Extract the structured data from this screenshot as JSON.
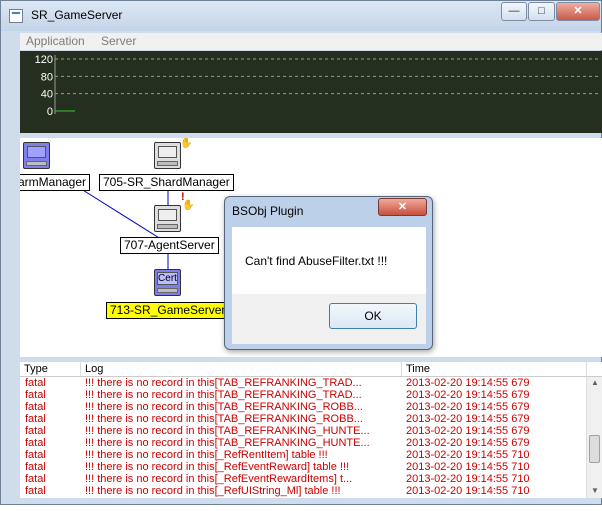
{
  "window": {
    "title": "SR_GameServer",
    "min_glyph": "—",
    "max_glyph": "□",
    "close_glyph": "✕"
  },
  "menu": {
    "items": [
      {
        "label": "Application"
      },
      {
        "label": "Server"
      }
    ]
  },
  "chart_data": {
    "type": "line",
    "title": "",
    "xlabel": "",
    "ylabel": "",
    "y_ticks": [
      120,
      80,
      40,
      0
    ],
    "ylim": [
      0,
      120
    ],
    "grid": true,
    "series": [
      {
        "values": [
          0,
          0
        ]
      }
    ],
    "colors": {
      "background": "#242f20",
      "grid": "#8fa08a",
      "tick_text": "#ffffff",
      "line": "#33cc33"
    }
  },
  "diagram": {
    "nodes": [
      {
        "label": "armManager",
        "icon": "computer-icon"
      },
      {
        "label": "705-SR_ShardManager",
        "icon": "computer-icon"
      },
      {
        "label": "707-AgentServer",
        "icon": "computer-icon"
      },
      {
        "label": "713-SR_GameServer",
        "icon": "certificate-icon",
        "cert_text": "Cert"
      }
    ],
    "hand_glyph": "✋",
    "alert_glyph": "!",
    "colors": {
      "link": "#0000cc",
      "highlight": "#ffff00"
    }
  },
  "log": {
    "columns": {
      "type": "Type",
      "log": "Log",
      "time": "Time"
    },
    "rows": [
      {
        "type": "fatal",
        "log": "!!! there is no record in this[TAB_REFRANKING_TRAD...",
        "time": "2013-02-20 19:14:55 679"
      },
      {
        "type": "fatal",
        "log": "!!! there is no record in this[TAB_REFRANKING_TRAD...",
        "time": "2013-02-20 19:14:55 679"
      },
      {
        "type": "fatal",
        "log": "!!! there is no record in this[TAB_REFRANKING_ROBB...",
        "time": "2013-02-20 19:14:55 679"
      },
      {
        "type": "fatal",
        "log": "!!! there is no record in this[TAB_REFRANKING_ROBB...",
        "time": "2013-02-20 19:14:55 679"
      },
      {
        "type": "fatal",
        "log": "!!! there is no record in this[TAB_REFRANKING_HUNTE...",
        "time": "2013-02-20 19:14:55 679"
      },
      {
        "type": "fatal",
        "log": "!!! there is no record in this[TAB_REFRANKING_HUNTE...",
        "time": "2013-02-20 19:14:55 679"
      },
      {
        "type": "fatal",
        "log": "!!! there is no record in this[_RefRentItem] table !!!",
        "time": "2013-02-20 19:14:55 710"
      },
      {
        "type": "fatal",
        "log": "!!! there is no record in this[_RefEventReward] table !!!",
        "time": "2013-02-20 19:14:55 710"
      },
      {
        "type": "fatal",
        "log": "!!! there is no record in this[_RefEventRewardItems] t...",
        "time": "2013-02-20 19:14:55 710"
      },
      {
        "type": "fatal",
        "log": "!!! there is no record in this[_RefUIString_Ml] table !!!",
        "time": "2013-02-20 19:14:55 710"
      }
    ],
    "colors": {
      "fatal": "#cc0000"
    }
  },
  "dialog": {
    "title": "BSObj Plugin",
    "close_glyph": "✕",
    "message": "Can't find AbuseFilter.txt !!!",
    "ok_label": "OK"
  }
}
